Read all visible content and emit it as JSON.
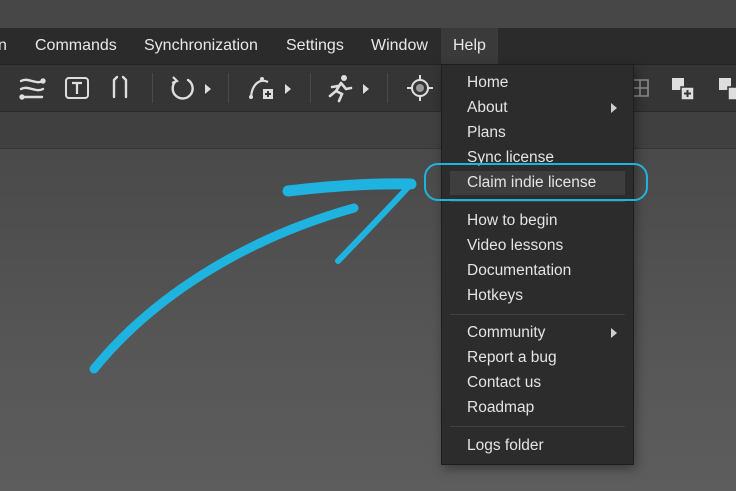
{
  "menubar": {
    "items": [
      {
        "label": "n"
      },
      {
        "label": "Commands"
      },
      {
        "label": "Synchronization"
      },
      {
        "label": "Settings"
      },
      {
        "label": "Window"
      },
      {
        "label": "Help"
      }
    ]
  },
  "toolbar": {
    "tools": [
      "bezier-tool-icon",
      "text-tool-icon",
      "bracket-tool-icon",
      "rotate-tool-icon",
      "path-add-tool-icon",
      "run-animation-icon",
      "target-icon",
      "grid-icon",
      "add-layer-icon",
      "layer-options-icon"
    ]
  },
  "help_menu": {
    "items": [
      {
        "label": "Home"
      },
      {
        "label": "About",
        "submenu": true
      },
      {
        "label": "Plans"
      },
      {
        "label": "Sync license"
      },
      {
        "label": "Claim indie license",
        "highlighted": true
      },
      {
        "label": "How to begin"
      },
      {
        "label": "Video lessons"
      },
      {
        "label": "Documentation"
      },
      {
        "label": "Hotkeys"
      },
      {
        "label": "Community",
        "submenu": true
      },
      {
        "label": "Report a bug"
      },
      {
        "label": "Contact us"
      },
      {
        "label": "Roadmap"
      },
      {
        "label": "Logs folder"
      }
    ]
  },
  "annotation": {
    "color": "#1fb3e0"
  }
}
